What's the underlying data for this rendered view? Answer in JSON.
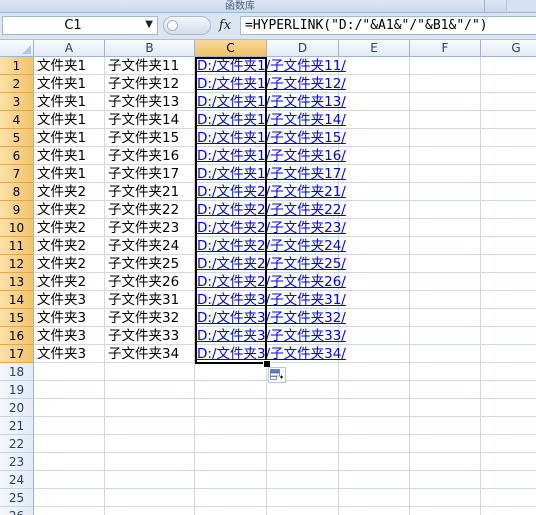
{
  "ribbon": {
    "group_label": "函数库"
  },
  "formula_bar": {
    "name_box": "C1",
    "fx_label": "fx",
    "formula": "=HYPERLINK(\"D:/\"&A1&\"/\"&B1&\"/\")"
  },
  "columns": [
    "A",
    "B",
    "C",
    "D",
    "E",
    "F",
    "G"
  ],
  "selected_column": "C",
  "rows": [
    {
      "n": "1",
      "a": "文件夹1",
      "b": "子文件夹11",
      "c": "D:/文件夹1/子文件夹11/"
    },
    {
      "n": "2",
      "a": "文件夹1",
      "b": "子文件夹12",
      "c": "D:/文件夹1/子文件夹12/"
    },
    {
      "n": "3",
      "a": "文件夹1",
      "b": "子文件夹13",
      "c": "D:/文件夹1/子文件夹13/"
    },
    {
      "n": "4",
      "a": "文件夹1",
      "b": "子文件夹14",
      "c": "D:/文件夹1/子文件夹14/"
    },
    {
      "n": "5",
      "a": "文件夹1",
      "b": "子文件夹15",
      "c": "D:/文件夹1/子文件夹15/"
    },
    {
      "n": "6",
      "a": "文件夹1",
      "b": "子文件夹16",
      "c": "D:/文件夹1/子文件夹16/"
    },
    {
      "n": "7",
      "a": "文件夹1",
      "b": "子文件夹17",
      "c": "D:/文件夹1/子文件夹17/"
    },
    {
      "n": "8",
      "a": "文件夹2",
      "b": "子文件夹21",
      "c": "D:/文件夹2/子文件夹21/"
    },
    {
      "n": "9",
      "a": "文件夹2",
      "b": "子文件夹22",
      "c": "D:/文件夹2/子文件夹22/"
    },
    {
      "n": "10",
      "a": "文件夹2",
      "b": "子文件夹23",
      "c": "D:/文件夹2/子文件夹23/"
    },
    {
      "n": "11",
      "a": "文件夹2",
      "b": "子文件夹24",
      "c": "D:/文件夹2/子文件夹24/"
    },
    {
      "n": "12",
      "a": "文件夹2",
      "b": "子文件夹25",
      "c": "D:/文件夹2/子文件夹25/"
    },
    {
      "n": "13",
      "a": "文件夹2",
      "b": "子文件夹26",
      "c": "D:/文件夹2/子文件夹26/"
    },
    {
      "n": "14",
      "a": "文件夹3",
      "b": "子文件夹31",
      "c": "D:/文件夹3/子文件夹31/"
    },
    {
      "n": "15",
      "a": "文件夹3",
      "b": "子文件夹32",
      "c": "D:/文件夹3/子文件夹32/"
    },
    {
      "n": "16",
      "a": "文件夹3",
      "b": "子文件夹33",
      "c": "D:/文件夹3/子文件夹33/"
    },
    {
      "n": "17",
      "a": "文件夹3",
      "b": "子文件夹34",
      "c": "D:/文件夹3/子文件夹34/"
    },
    {
      "n": "18",
      "a": "",
      "b": "",
      "c": ""
    },
    {
      "n": "19",
      "a": "",
      "b": "",
      "c": ""
    },
    {
      "n": "20",
      "a": "",
      "b": "",
      "c": ""
    },
    {
      "n": "21",
      "a": "",
      "b": "",
      "c": ""
    },
    {
      "n": "22",
      "a": "",
      "b": "",
      "c": ""
    },
    {
      "n": "23",
      "a": "",
      "b": "",
      "c": ""
    },
    {
      "n": "24",
      "a": "",
      "b": "",
      "c": ""
    },
    {
      "n": "25",
      "a": "",
      "b": "",
      "c": ""
    },
    {
      "n": "26",
      "a": "",
      "b": "",
      "c": ""
    }
  ],
  "selected_rows": 17,
  "colors": {
    "link": "#0000ee",
    "selection_header": "#f1c15f",
    "gridline": "#d0d7e5"
  }
}
